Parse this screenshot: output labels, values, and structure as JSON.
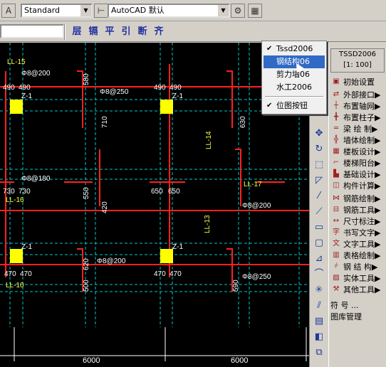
{
  "toolbar": {
    "text_style": "Standard",
    "dim_style": "AutoCAD 默认",
    "settings_icon": "gear-icon",
    "layer_icon": "layer-icon"
  },
  "toolbar2": {
    "buttons": [
      "层",
      "镉",
      "平",
      "引",
      "断",
      "齐"
    ]
  },
  "drawing": {
    "labels": {
      "ll15": "LL-15",
      "ll16": "LL-16",
      "ll14": "LL-14",
      "ll17": "LL-17",
      "ll13": "LL-13",
      "ll13b": "LL-13",
      "ll10": "LL-10",
      "dim490_1": "490",
      "dim490_2": "490",
      "dim490_3": "490",
      "dim490_4": "490",
      "z1_a": "Z-1",
      "z1_b": "Z-1",
      "z1_c": "Z-1",
      "z1_d": "Z-1",
      "b180_1": "Φ8@200",
      "b180_2": "Φ8@180",
      "b180_3": "Φ8@250",
      "b180_4": "Φ8@200",
      "b180_5": "Φ8@250",
      "b180_6": "Φ8@200",
      "d730_1": "730",
      "d730_2": "730",
      "d650_1": "650",
      "d650_2": "650",
      "d470_1": "470",
      "d470_2": "470",
      "d470_3": "470",
      "d470_4": "470",
      "span1": "6000",
      "span2": "6000",
      "d580": "580",
      "d710": "710",
      "d630": "630",
      "d550": "550",
      "d420": "420",
      "d620": "620",
      "d500": "500",
      "d590": "590"
    }
  },
  "vtoolbar": {
    "icons": [
      "move-icon",
      "rotate-icon",
      "stretch-icon",
      "scale-icon",
      "trim-icon",
      "extend-icon",
      "break-icon",
      "rect-icon",
      "chamfer-icon",
      "fillet-icon",
      "explode-icon",
      "offset-icon",
      "array-icon",
      "mirror-icon",
      "erase-icon",
      "copy-icon"
    ]
  },
  "panel": {
    "title_line1": "TSSD2006",
    "title_line2": "[1: 100]",
    "items": [
      {
        "icon": "settings-icon",
        "label": "初始设置"
      },
      {
        "icon": "interface-icon",
        "label": "外部接口▶"
      },
      {
        "icon": "grid-icon",
        "label": "布置轴网▶"
      },
      {
        "icon": "column-icon",
        "label": "布置柱子▶"
      },
      {
        "icon": "beam-icon",
        "label": "梁 绘 制▶"
      },
      {
        "icon": "wall-icon",
        "label": "墙体绘制▶"
      },
      {
        "icon": "slab-icon",
        "label": "楼板设计▶"
      },
      {
        "icon": "stair-icon",
        "label": "楼梯阳台▶"
      },
      {
        "icon": "foundation-icon",
        "label": "基础设计▶"
      },
      {
        "icon": "calc-icon",
        "label": "构件计算▶"
      },
      {
        "icon": "rebar-icon",
        "label": "钢筋绘制▶"
      },
      {
        "icon": "rebar-tool-icon",
        "label": "钢筋工具▶"
      },
      {
        "icon": "dimension-icon",
        "label": "尺寸标注▶"
      },
      {
        "icon": "text-icon",
        "label": "书写文字▶"
      },
      {
        "icon": "text-tool-icon",
        "label": "文字工具▶"
      },
      {
        "icon": "table-icon",
        "label": "表格绘制▶"
      },
      {
        "icon": "steel-icon",
        "label": "钢 结 构▶"
      },
      {
        "icon": "solid-tool-icon",
        "label": "实体工具▶"
      },
      {
        "icon": "other-tool-icon",
        "label": "其他工具▶"
      },
      {
        "icon": "",
        "label": "符 号 ..."
      },
      {
        "icon": "",
        "label": "图库管理"
      }
    ]
  },
  "popup": {
    "items": [
      {
        "label": "Tssd2006",
        "checked": true,
        "selected": false
      },
      {
        "label": "钢结构06",
        "checked": false,
        "selected": true
      },
      {
        "label": "剪力墙06",
        "checked": false,
        "selected": false
      },
      {
        "label": "水工2006",
        "checked": false,
        "selected": false
      },
      {
        "label": "位图按钮",
        "checked": true,
        "selected": false
      }
    ]
  },
  "colors": {
    "canvas": "#000000",
    "beam": "#ff2020",
    "grid": "#00c8c8",
    "text": "#ffffff",
    "label": "#ffff40",
    "column": "#ffff00",
    "selected": "#316ac5"
  }
}
